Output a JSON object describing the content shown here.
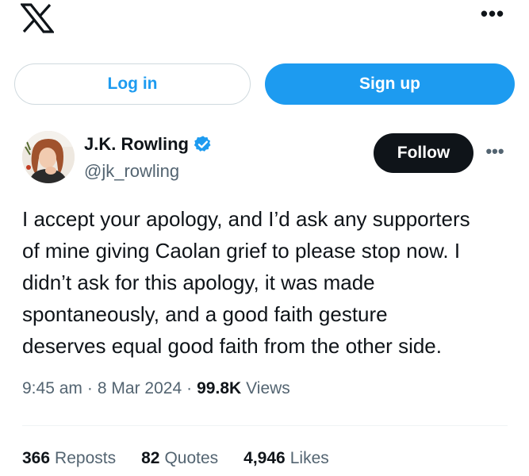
{
  "header": {
    "logo_icon": "x-logo-icon",
    "more_icon": "more-horizontal-icon",
    "more_label": "•••"
  },
  "auth": {
    "login_label": "Log in",
    "signup_label": "Sign up"
  },
  "tweet": {
    "author": {
      "display_name": "J.K. Rowling",
      "handle": "@jk_rowling",
      "verified": true
    },
    "follow_label": "Follow",
    "more_label": "•••",
    "text": "I accept your apology, and I’d ask any supporters\nof mine giving Caolan grief to please stop now. I\ndidn’t ask for this apology, it was made\nspontaneously, and a good faith gesture\ndeserves equal good faith from the other side.",
    "time": "9:45 am",
    "separator": "·",
    "date": "8 Mar 2024",
    "views_count": "99.8K",
    "views_label": "Views",
    "stats": {
      "reposts_count": "366",
      "reposts_label": "Reposts",
      "quotes_count": "82",
      "quotes_label": "Quotes",
      "likes_count": "4,946",
      "likes_label": "Likes"
    }
  },
  "colors": {
    "accent": "#1d9bf0",
    "text_primary": "#0f1419",
    "text_secondary": "#536471",
    "border": "#cfd9de"
  }
}
